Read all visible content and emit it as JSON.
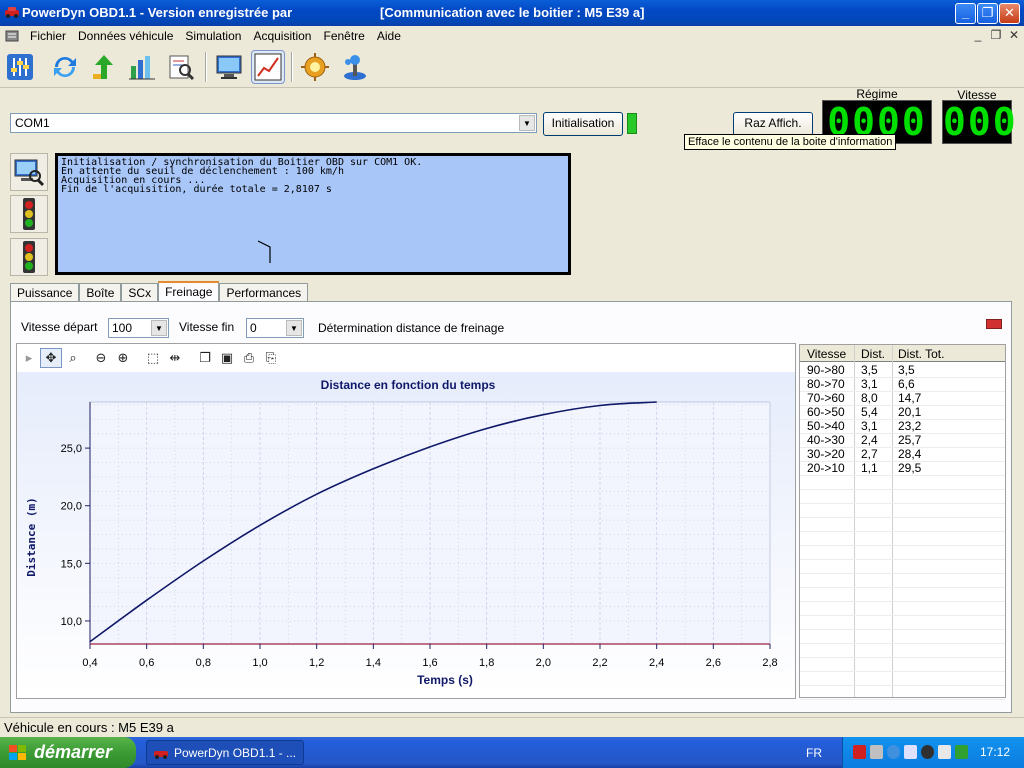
{
  "window": {
    "title": "PowerDyn OBD1.1 - Version enregistrée par",
    "status_title": "[Communication avec le boitier : M5 E39 a]"
  },
  "menu": [
    "Fichier",
    "Données véhicule",
    "Simulation",
    "Acquisition",
    "Fenêtre",
    "Aide"
  ],
  "toolbar_icons": [
    "settings-sliders-icon",
    "refresh-icon",
    "arrows-up-icon",
    "bar-chart-icon",
    "search-report-icon",
    "monitor-icon",
    "line-chart-icon",
    "gear-sun-icon",
    "joystick-icon"
  ],
  "connection": {
    "port": "COM1",
    "init_label": "Initialisation",
    "raz_label": "Raz Affich.",
    "raz_tooltip": "Efface le contenu de la boite d'information"
  },
  "displays": {
    "regime_label": "Régime",
    "regime_value": "0000",
    "vitesse_label": "Vitesse",
    "vitesse_value": "000"
  },
  "info_lines": [
    "Initialisation / synchronisation du Boitier OBD sur COM1 OK.",
    "En attente du seuil de déclenchement : 100 km/h",
    "Acquisition en cours ...",
    "Fin de l'acquisition, durée totale = 2,8107 s"
  ],
  "tabs": [
    "Puissance",
    "Boîte",
    "SCx",
    "Freinage",
    "Performances"
  ],
  "active_tab": "Freinage",
  "params": {
    "vitesse_depart_label": "Vitesse départ",
    "vitesse_depart_value": "100",
    "vitesse_fin_label": "Vitesse fin",
    "vitesse_fin_value": "0",
    "description": "Détermination distance de freinage"
  },
  "chart_data": {
    "type": "line",
    "title": "Distance en fonction du temps",
    "xlabel": "Temps (s)",
    "ylabel": "Distance (m)",
    "xlim": [
      0.4,
      2.8
    ],
    "ylim": [
      8.0,
      29.0
    ],
    "xticks": [
      "0,4",
      "0,6",
      "0,8",
      "1,0",
      "1,2",
      "1,4",
      "1,6",
      "1,8",
      "2,0",
      "2,2",
      "2,4",
      "2,6",
      "2,8"
    ],
    "yticks": [
      "10,0",
      "15,0",
      "20,0",
      "25,0"
    ],
    "grid": true,
    "series": [
      {
        "x": [
          0.4,
          0.6,
          0.8,
          1.0,
          1.2,
          1.4,
          1.6,
          1.8,
          2.0,
          2.2,
          2.4
        ],
        "y": [
          8.2,
          11.8,
          15.2,
          18.3,
          21.0,
          23.2,
          25.1,
          26.7,
          27.9,
          28.7,
          29.0
        ]
      }
    ],
    "line_color": "#101868"
  },
  "table": {
    "headers": [
      "Vitesse",
      "Dist.",
      "Dist. Tot."
    ],
    "rows": [
      [
        "90->80",
        "3,5",
        "3,5"
      ],
      [
        "80->70",
        "3,1",
        "6,6"
      ],
      [
        "70->60",
        "8,0",
        "14,7"
      ],
      [
        "60->50",
        "5,4",
        "20,1"
      ],
      [
        "50->40",
        "3,1",
        "23,2"
      ],
      [
        "40->30",
        "2,4",
        "25,7"
      ],
      [
        "30->20",
        "2,7",
        "28,4"
      ],
      [
        "20->10",
        "1,1",
        "29,5"
      ]
    ]
  },
  "status": "Véhicule en cours : M5 E39 a",
  "taskbar": {
    "start_label": "démarrer",
    "task_label": "PowerDyn OBD1.1 - ...",
    "language": "FR",
    "clock": "17:12"
  }
}
